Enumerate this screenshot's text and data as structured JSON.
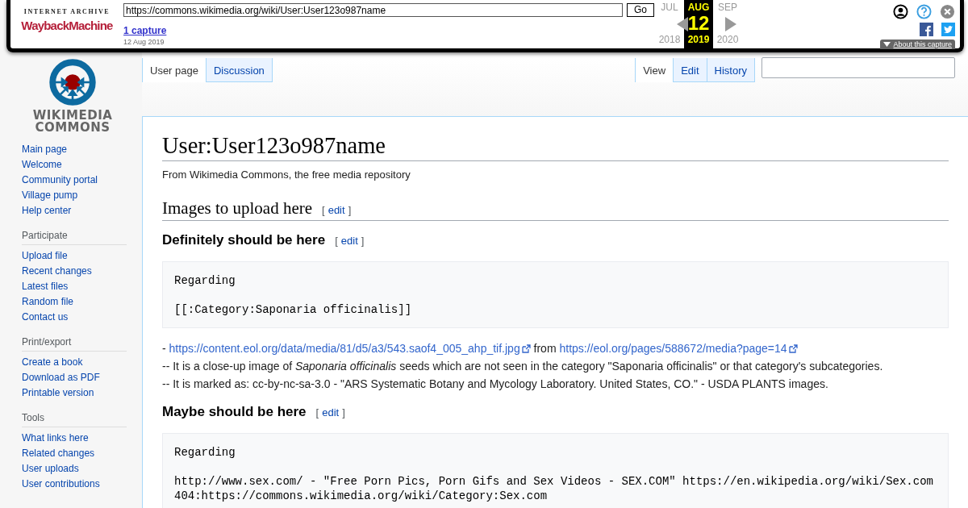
{
  "wayback": {
    "logo_top": "INTERNET ARCHIVE",
    "logo_main": "WaybackMachine",
    "url": "https://commons.wikimedia.org/wiki/User:User123o987name",
    "go": "Go",
    "captures": "1 capture",
    "capture_date": "12 Aug 2019",
    "calendar": [
      {
        "month": "JUL",
        "year": "2018",
        "selected": false
      },
      {
        "month": "AUG",
        "day": "12",
        "year": "2019",
        "selected": true
      },
      {
        "month": "SEP",
        "year": "2020",
        "selected": false
      }
    ],
    "about": "About this capture"
  },
  "logo": {
    "line1": "WIKIMEDIA",
    "line2": "COMMONS"
  },
  "tabs_left": [
    {
      "label": "User page",
      "selected": true
    },
    {
      "label": "Discussion",
      "selected": false
    }
  ],
  "tabs_right": [
    {
      "label": "View",
      "selected": true
    },
    {
      "label": "Edit",
      "selected": false
    },
    {
      "label": "History",
      "selected": false
    }
  ],
  "sidebar": {
    "nav": [
      "Main page",
      "Welcome",
      "Community portal",
      "Village pump",
      "Help center"
    ],
    "portlets": [
      {
        "heading": "Participate",
        "items": [
          "Upload file",
          "Recent changes",
          "Latest files",
          "Random file",
          "Contact us"
        ]
      },
      {
        "heading": "Print/export",
        "items": [
          "Create a book",
          "Download as PDF",
          "Printable version"
        ]
      },
      {
        "heading": "Tools",
        "items": [
          "What links here",
          "Related changes",
          "User uploads",
          "User contributions"
        ]
      }
    ]
  },
  "article": {
    "title": "User:User123o987name",
    "tagline": "From Wikimedia Commons, the free media repository",
    "blocks": [
      {
        "kind": "h2",
        "text": "Images to upload here",
        "bracket_open": "[",
        "edit": "edit",
        "bracket_close": "]"
      },
      {
        "kind": "h3",
        "text": "Definitely should be here",
        "bracket_open": "[",
        "edit": "edit",
        "bracket_close": "]"
      },
      {
        "kind": "pre",
        "text": "Regarding\n\n[[:Category:Saponaria officinalis]]"
      },
      {
        "kind": "para",
        "segments": [
          {
            "kind": "text",
            "text": "- "
          },
          {
            "kind": "extlink",
            "text": "https://content.eol.org/data/media/81/d5/a3/543.saof4_005_ahp_tif.jpg"
          },
          {
            "kind": "text",
            "text": " from "
          },
          {
            "kind": "extlink",
            "text": "https://eol.org/pages/588672/media?page=14"
          }
        ]
      },
      {
        "kind": "para",
        "segments": [
          {
            "kind": "text",
            "text": "-- It is a close-up image of *Saponaria officinalis* seeds which are not seen in the category \"Saponaria officinalis\" or that category's subcategories."
          }
        ]
      },
      {
        "kind": "para",
        "segments": [
          {
            "kind": "text",
            "text": "-- It is marked as: cc-by-nc-sa-3.0 - \"ARS Systematic Botany and Mycology Laboratory. United States, CO.\" - USDA PLANTS images."
          }
        ]
      },
      {
        "kind": "h3",
        "text": "Maybe should be here",
        "bracket_open": "[",
        "edit": "edit",
        "bracket_close": "]"
      },
      {
        "kind": "pre",
        "text": "Regarding\n\nhttp://www.sex.com/ - \"Free Porn Pics, Porn Gifs and Sex Videos - SEX.COM\" https://en.wikipedia.org/wiki/Sex.com\n404:https://commons.wikimedia.org/wiki/Category:Sex.com"
      }
    ]
  }
}
